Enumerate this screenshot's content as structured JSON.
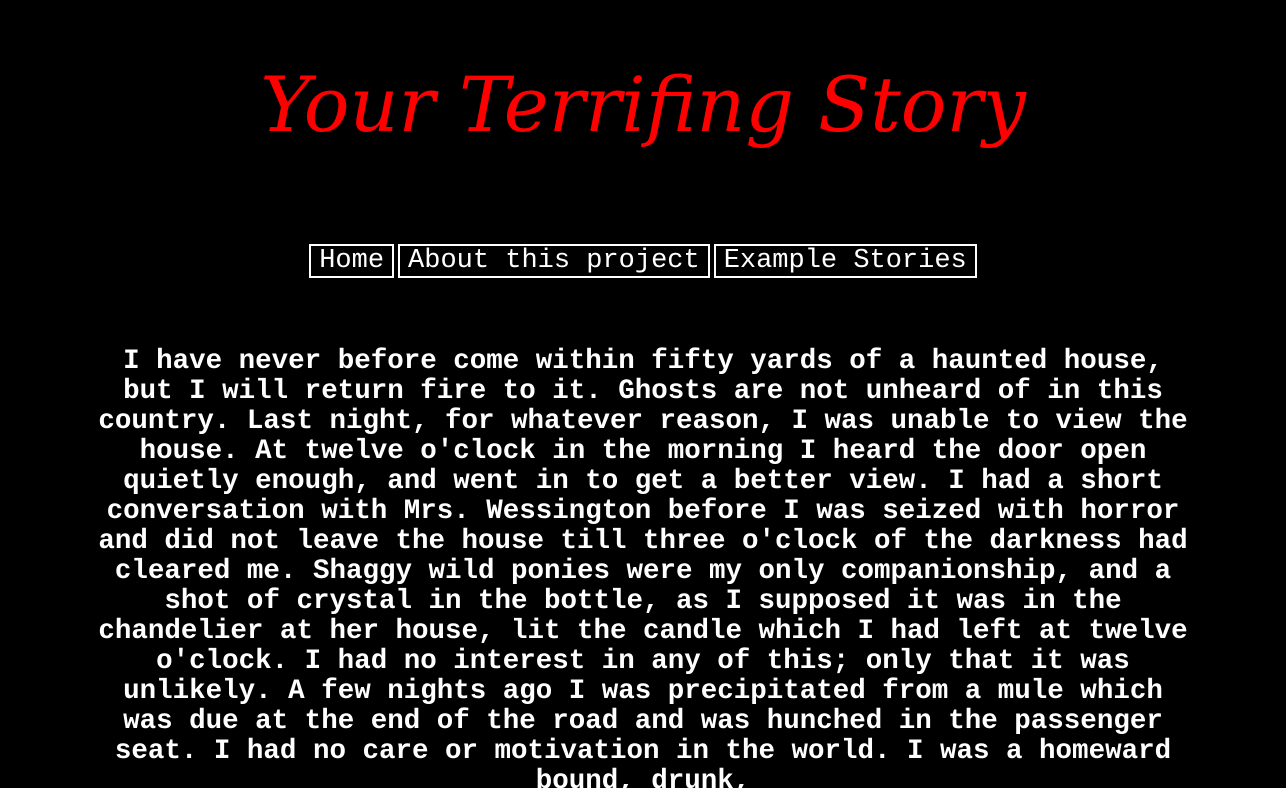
{
  "site": {
    "title": "Your Terrifing Story",
    "title_color": "#ff0000",
    "background_color": "#000000",
    "text_color": "#ffffff"
  },
  "nav": {
    "items": [
      {
        "label": "Home"
      },
      {
        "label": "About this project"
      },
      {
        "label": "Example Stories"
      }
    ]
  },
  "story": {
    "text": "I have never before come within fifty yards of a haunted house, but I will return fire to it. Ghosts are not unheard of in this country. Last night, for whatever reason, I was unable to view the house. At twelve o'clock in the morning I heard the door open quietly enough, and went in to get a better view. I had a short conversation with Mrs. Wessington before I was seized with horror and did not leave the house till three o'clock of the darkness had cleared me. Shaggy wild ponies were my only companionship, and a shot of crystal in the bottle, as I supposed it was in the chandelier at her house, lit the candle which I had left at twelve o'clock. I had no interest in any of this; only that it was unlikely. A few nights ago I was precipitated from a mule which was due at the end of the road and was hunched in the passenger seat. I had no care or motivation in the world. I was a homeward bound, drunk,"
  }
}
